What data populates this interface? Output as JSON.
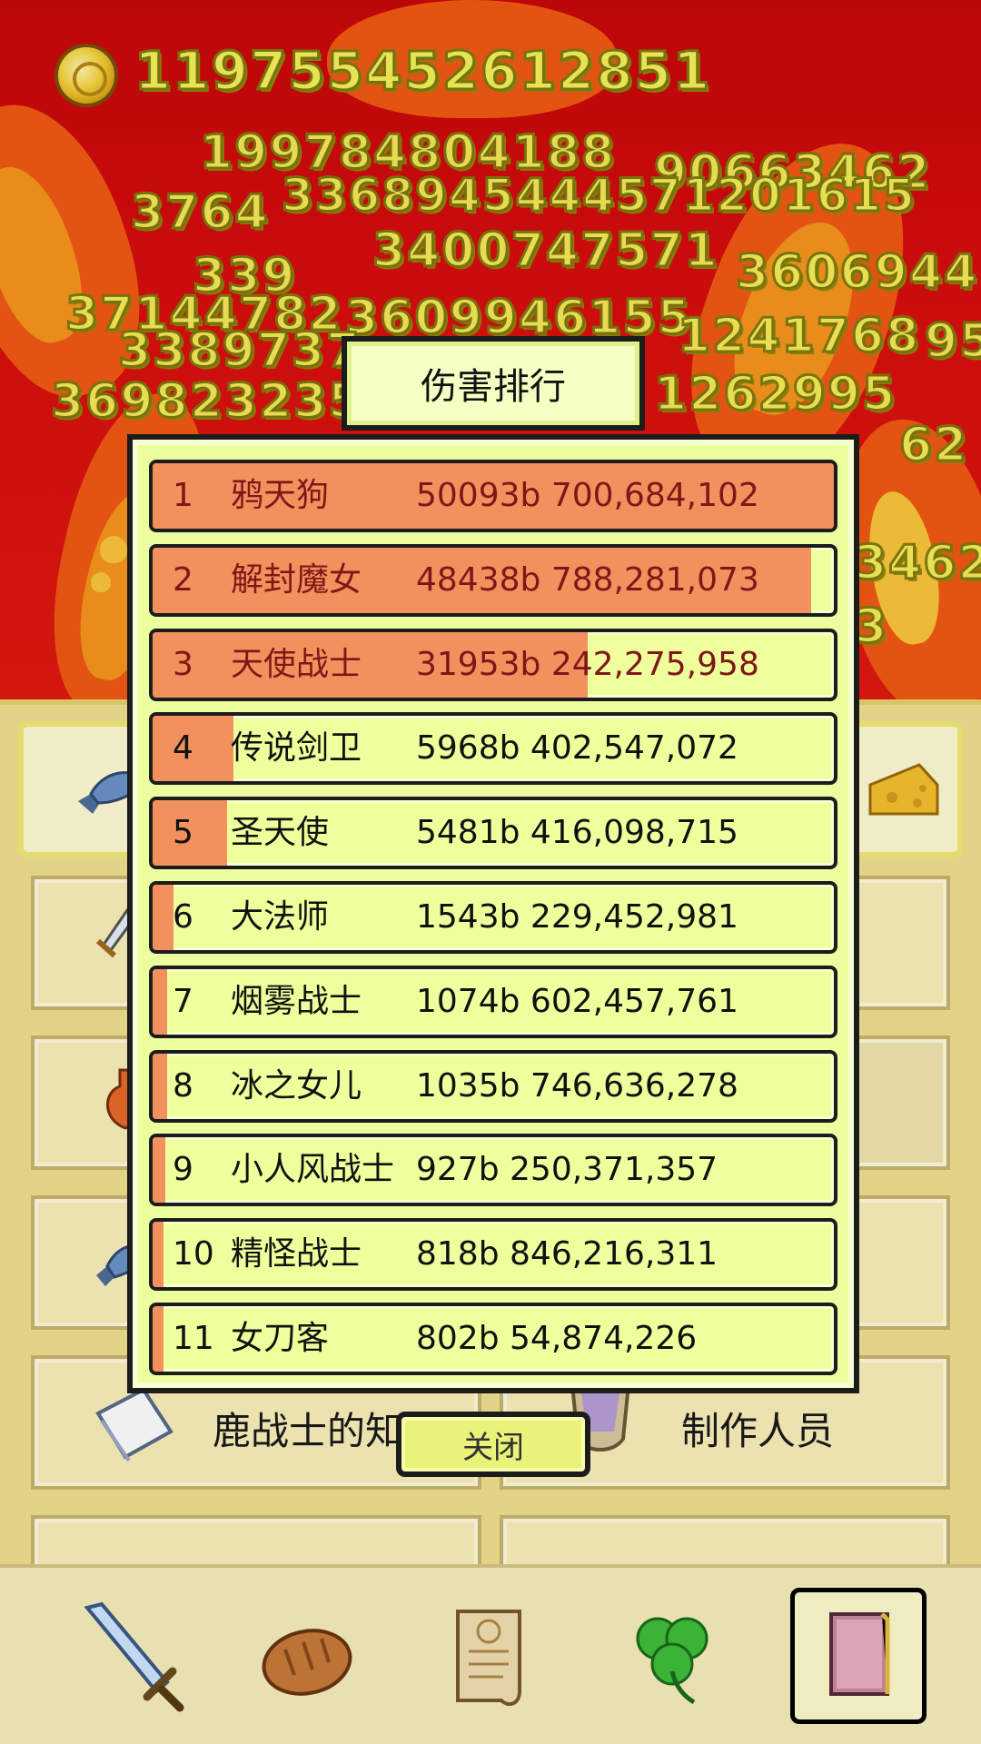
{
  "hud": {
    "coin_count": "119755452612851",
    "damage_popups": [
      "199784804188",
      "90663462",
      "3764",
      "3368945444571201615",
      "3400747571",
      "339",
      "3606944",
      "37144782",
      "3609946155",
      "1241768",
      "95",
      "3389737",
      "369823235",
      "1262995",
      "62",
      "3462",
      "3"
    ]
  },
  "menu": {
    "tiles": [
      {
        "label": "鹿战士的知识",
        "icon": "book-icon"
      },
      {
        "label": "制作人员",
        "icon": "trophy-cup-icon"
      }
    ]
  },
  "bottom_nav": {
    "items": [
      {
        "name": "sword",
        "icon": "sword-icon"
      },
      {
        "name": "bread",
        "icon": "bread-icon"
      },
      {
        "name": "scroll",
        "icon": "scroll-icon"
      },
      {
        "name": "clover",
        "icon": "clover-icon"
      },
      {
        "name": "book",
        "icon": "book-icon",
        "active": true
      }
    ]
  },
  "ranking": {
    "title": "伤害排行",
    "close_label": "关闭",
    "rows": [
      {
        "rank": "1",
        "name": "鸦天狗",
        "damage": "50093b 700,684,102",
        "bar": 1.0
      },
      {
        "rank": "2",
        "name": "解封魔女",
        "damage": "48438b 788,281,073",
        "bar": 0.967
      },
      {
        "rank": "3",
        "name": "天使战士",
        "damage": "31953b 242,275,958",
        "bar": 0.638
      },
      {
        "rank": "4",
        "name": "传说剑卫",
        "damage": "5968b 402,547,072",
        "bar": 0.119
      },
      {
        "rank": "5",
        "name": "圣天使",
        "damage": "5481b 416,098,715",
        "bar": 0.109
      },
      {
        "rank": "6",
        "name": "大法师",
        "damage": "1543b 229,452,981",
        "bar": 0.031
      },
      {
        "rank": "7",
        "name": "烟雾战士",
        "damage": "1074b 602,457,761",
        "bar": 0.021
      },
      {
        "rank": "8",
        "name": "冰之女儿",
        "damage": "1035b 746,636,278",
        "bar": 0.021
      },
      {
        "rank": "9",
        "name": "小人风战士",
        "damage": "927b 250,371,357",
        "bar": 0.018
      },
      {
        "rank": "10",
        "name": "精怪战士",
        "damage": "818b 846,216,311",
        "bar": 0.016
      },
      {
        "rank": "11",
        "name": "女刀客",
        "damage": "802b 54,874,226",
        "bar": 0.016
      }
    ]
  },
  "colors": {
    "background": "#c8080a",
    "bar_fill": "#f2905e",
    "row_bg": "#eeff9c",
    "panel_bg": "#ecff9e",
    "gold_text": "#f7f25b"
  }
}
